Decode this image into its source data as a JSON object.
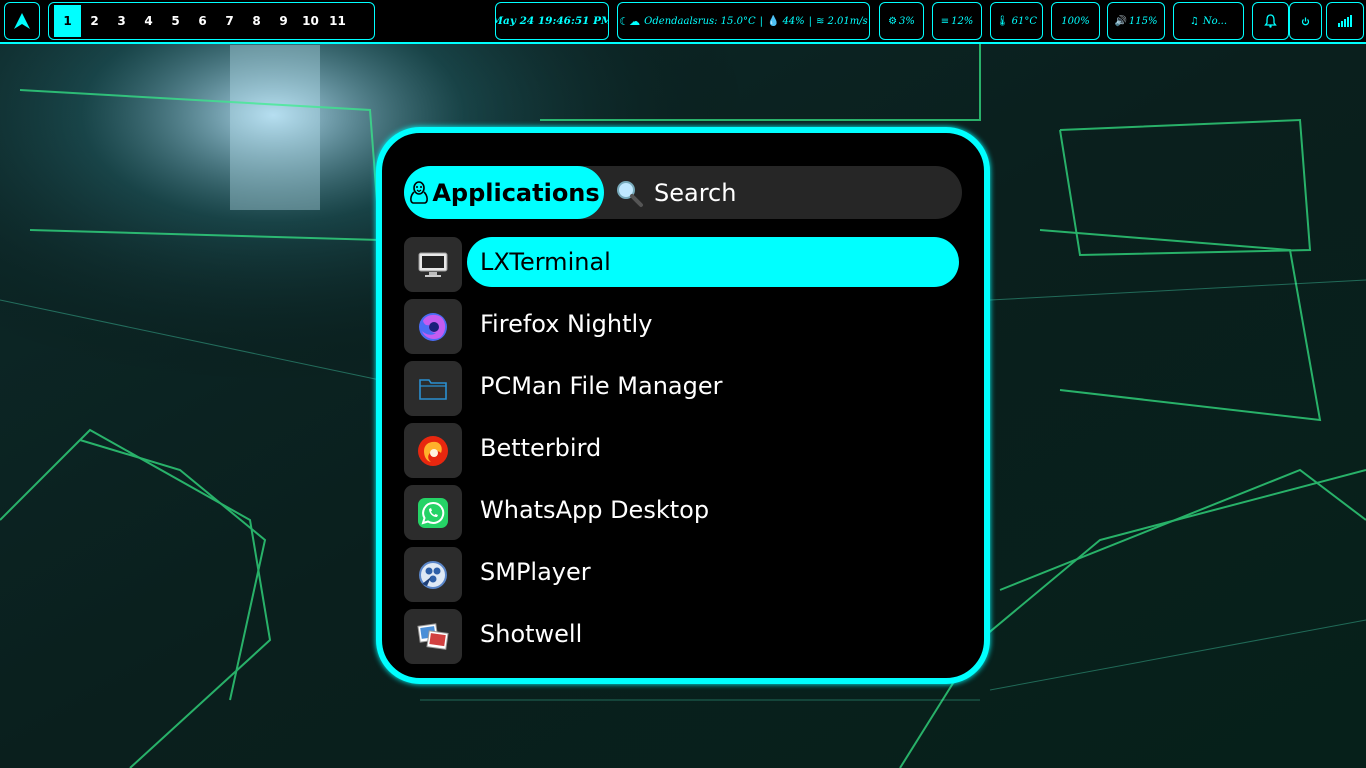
{
  "topbar": {
    "workspaces": [
      "1",
      "2",
      "3",
      "4",
      "5",
      "6",
      "7",
      "8",
      "9",
      "10",
      "11"
    ],
    "active_workspace": "1",
    "clock": "May 24 19:46:51 PM",
    "weather": {
      "location": "Odendaalsrus: 15.0°C",
      "humidity": "44%",
      "wind": "2.01m/s"
    },
    "cpu": "3%",
    "memory": "12%",
    "temperature": "61°C",
    "brightness": "100%",
    "volume": "115%",
    "music": "No...",
    "accent_color": "#00ffff"
  },
  "launcher": {
    "mode_label": "Applications",
    "search_placeholder": "Search",
    "selected_index": 0,
    "apps": [
      {
        "label": "LXTerminal",
        "icon": "terminal-icon"
      },
      {
        "label": "Firefox Nightly",
        "icon": "firefox-nightly-icon"
      },
      {
        "label": "PCMan File Manager",
        "icon": "folder-icon"
      },
      {
        "label": "Betterbird",
        "icon": "betterbird-icon"
      },
      {
        "label": "WhatsApp Desktop",
        "icon": "whatsapp-icon"
      },
      {
        "label": "SMPlayer",
        "icon": "smplayer-icon"
      },
      {
        "label": "Shotwell",
        "icon": "shotwell-icon"
      }
    ]
  }
}
